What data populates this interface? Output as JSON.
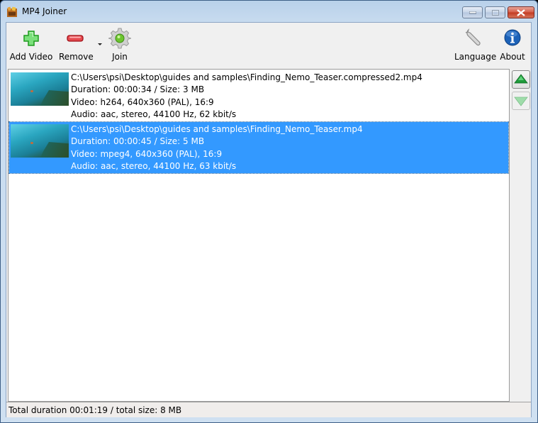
{
  "window": {
    "title": "MP4 Joiner",
    "controls": {
      "minimize": "minimize",
      "maximize": "maximize",
      "close": "close"
    }
  },
  "toolbar": {
    "add_video": {
      "label": "Add Video",
      "icon": "plus-icon"
    },
    "remove": {
      "label": "Remove",
      "icon": "minus-icon"
    },
    "join": {
      "label": "Join",
      "icon": "gear-icon"
    },
    "language": {
      "label": "Language",
      "icon": "wrench-icon"
    },
    "about": {
      "label": "About",
      "icon": "info-icon"
    }
  },
  "files": [
    {
      "path": "C:\\Users\\psi\\Desktop\\guides and samples\\Finding_Nemo_Teaser.compressed2.mp4",
      "duration_size": "Duration: 00:00:34 / Size: 3 MB",
      "video": "Video: h264, 640x360 (PAL), 16:9",
      "audio": "Audio: aac, stereo, 44100 Hz, 62 kbit/s",
      "selected": false
    },
    {
      "path": "C:\\Users\\psi\\Desktop\\guides and samples\\Finding_Nemo_Teaser.mp4",
      "duration_size": "Duration: 00:00:45 / Size: 5 MB",
      "video": "Video: mpeg4, 640x360 (PAL), 16:9",
      "audio": "Audio: aac, stereo, 44100 Hz, 63 kbit/s",
      "selected": true
    }
  ],
  "side_buttons": {
    "move_up": "move up",
    "move_down": "move down"
  },
  "status": {
    "text": "Total duration 00:01:19 / total size: 8 MB"
  },
  "colors": {
    "selection": "#3399ff",
    "add": "#2fc42f",
    "remove": "#d8222a",
    "about": "#1c62b8"
  }
}
